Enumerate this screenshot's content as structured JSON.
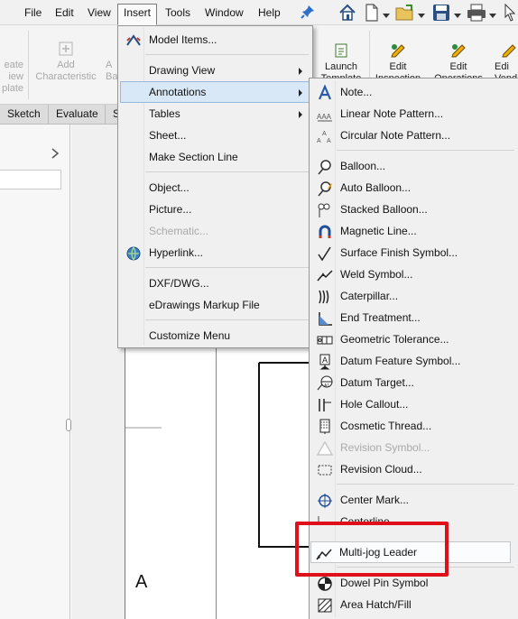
{
  "menubar": {
    "items": [
      {
        "label": "File"
      },
      {
        "label": "Edit"
      },
      {
        "label": "View"
      },
      {
        "label": "Insert"
      },
      {
        "label": "Tools"
      },
      {
        "label": "Window"
      },
      {
        "label": "Help"
      }
    ],
    "active": "Insert"
  },
  "ribbon": {
    "buttons": [
      {
        "label_line1": "eate",
        "label_line2": "iew",
        "label_line3": "plate"
      },
      {
        "label_line1": "Add",
        "label_line2": "Characteristic"
      },
      {
        "label_line1": "A",
        "label_line2": "Ba"
      },
      {
        "label_line1": "Launch",
        "label_line2": "Template"
      },
      {
        "label_line1": "Edit",
        "label_line2": "Inspection"
      },
      {
        "label_line1": "Edit",
        "label_line2": "Operations"
      },
      {
        "label_line1": "Edi",
        "label_line2": "Vend"
      }
    ]
  },
  "tabs": [
    {
      "label": "Sketch"
    },
    {
      "label": "Evaluate"
    },
    {
      "label": "S"
    }
  ],
  "sheet": {
    "letter": "A"
  },
  "insert_menu": {
    "items": [
      {
        "label": "Model Items...",
        "icon": "model-items-icon"
      },
      {
        "label": "Drawing View",
        "submenu": true
      },
      {
        "label": "Annotations",
        "submenu": true,
        "highlighted": true
      },
      {
        "label": "Tables",
        "submenu": true
      },
      {
        "label": "Sheet..."
      },
      {
        "label": "Make Section Line"
      },
      {
        "label": "Object..."
      },
      {
        "label": "Picture..."
      },
      {
        "label": "Schematic...",
        "disabled": true
      },
      {
        "label": "Hyperlink...",
        "icon": "globe-icon"
      },
      {
        "label": "DXF/DWG..."
      },
      {
        "label": "eDrawings Markup File"
      },
      {
        "label": "Customize Menu"
      }
    ]
  },
  "annotations_menu": {
    "items": [
      {
        "label": "Note...",
        "icon": "note-icon"
      },
      {
        "label": "Linear Note Pattern...",
        "icon": "linear-note-pattern-icon"
      },
      {
        "label": "Circular Note Pattern...",
        "icon": "circular-note-pattern-icon"
      },
      {
        "label": "Balloon...",
        "icon": "balloon-icon"
      },
      {
        "label": "Auto Balloon...",
        "icon": "auto-balloon-icon"
      },
      {
        "label": "Stacked Balloon...",
        "icon": "stacked-balloon-icon"
      },
      {
        "label": "Magnetic Line...",
        "icon": "magnetic-line-icon"
      },
      {
        "label": "Surface Finish Symbol...",
        "icon": "surface-finish-icon"
      },
      {
        "label": "Weld Symbol...",
        "icon": "weld-symbol-icon"
      },
      {
        "label": "Caterpillar...",
        "icon": "caterpillar-icon"
      },
      {
        "label": "End Treatment...",
        "icon": "end-treatment-icon"
      },
      {
        "label": "Geometric Tolerance...",
        "icon": "geometric-tolerance-icon"
      },
      {
        "label": "Datum Feature Symbol...",
        "icon": "datum-feature-icon"
      },
      {
        "label": "Datum Target...",
        "icon": "datum-target-icon"
      },
      {
        "label": "Hole Callout...",
        "icon": "hole-callout-icon"
      },
      {
        "label": "Cosmetic Thread...",
        "icon": "cosmetic-thread-icon"
      },
      {
        "label": "Revision Symbol...",
        "icon": "revision-symbol-icon",
        "disabled": true
      },
      {
        "label": "Revision Cloud...",
        "icon": "revision-cloud-icon"
      },
      {
        "label": "Center Mark...",
        "icon": "center-mark-icon"
      },
      {
        "label": "Centerline...",
        "icon": "centerline-icon"
      },
      {
        "label": "Multi-jog Leader",
        "icon": "multi-jog-leader-icon",
        "highlighted": true
      },
      {
        "label": "Dowel Pin Symbol",
        "icon": "dowel-pin-icon"
      },
      {
        "label": "Area Hatch/Fill",
        "icon": "area-hatch-icon"
      }
    ]
  },
  "colors": {
    "highlight_bg": "#d9e8f7",
    "highlight_border": "#98b9de",
    "callout_red": "#e0101a"
  }
}
